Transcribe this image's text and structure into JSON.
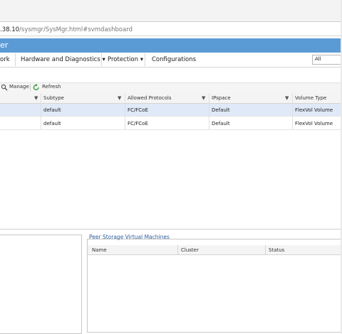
{
  "browser": {
    "url_host": ".38.10",
    "url_path": "/sysmgr/SysMgr.html#svmdashboard"
  },
  "app": {
    "title_fragment": "er"
  },
  "menu": {
    "items": [
      "ork",
      "Hardware and Diagnostics ▾",
      "Protection ▾",
      "Configurations"
    ],
    "scope_select": "All"
  },
  "toolbar": {
    "manage_label": "Manage",
    "refresh_label": "Refresh"
  },
  "table": {
    "columns": [
      "Subtype",
      "Allowed Protocols",
      "IPspace",
      "Volume Type"
    ],
    "rows": [
      [
        "default",
        "FC/FCoE",
        "Default",
        "FlexVol Volume"
      ],
      [
        "default",
        "FC/FCoE",
        "Default",
        "FlexVol Volume"
      ]
    ]
  },
  "peer_panel": {
    "title": "Peer Storage Virtual Machines",
    "columns": [
      "Name",
      "Cluster",
      "Status"
    ]
  },
  "colors": {
    "banner": "#5b9bd5",
    "selected_row": "#dfe9f7",
    "peer_title": "#2f5fa0"
  }
}
